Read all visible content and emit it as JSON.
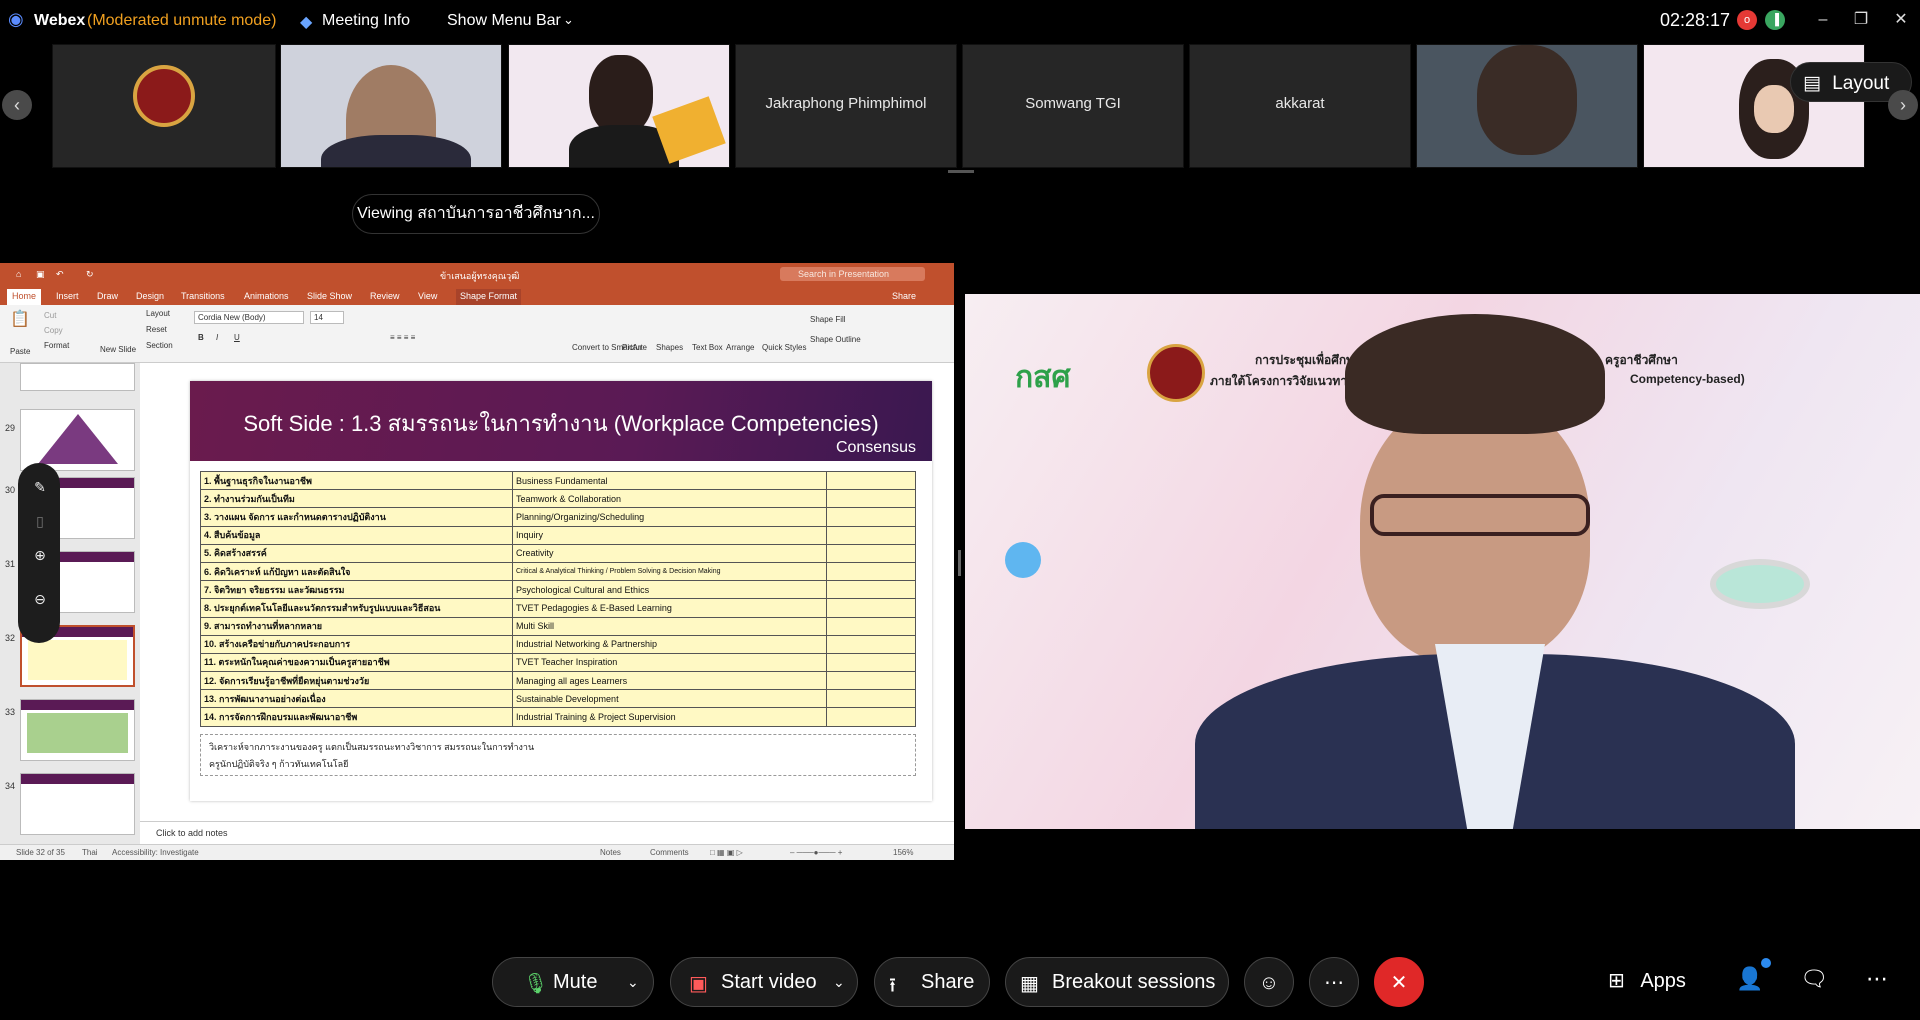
{
  "titlebar": {
    "app": "Webex",
    "mode": "(Moderated unmute mode)",
    "meeting_info": "Meeting Info",
    "show_menu": "Show Menu Bar",
    "time": "02:28:17"
  },
  "participants": [
    {
      "name": "Jakraphong Phimphimol"
    },
    {
      "name": "Somwang TGI"
    },
    {
      "name": "akkarat"
    }
  ],
  "layout_button": "Layout",
  "viewing": "Viewing สถาบันการอาชีวศึกษาก...",
  "ppt": {
    "doc_title": "ข้าเสนอผู้ทรงคุณวุฒิ",
    "search_placeholder": "Search in Presentation",
    "tabs": [
      "Home",
      "Insert",
      "Draw",
      "Design",
      "Transitions",
      "Animations",
      "Slide Show",
      "Review",
      "View",
      "Shape Format"
    ],
    "share": "Share",
    "ribbon": {
      "paste": "Paste",
      "cut": "Cut",
      "copy": "Copy",
      "format": "Format",
      "new_slide": "New Slide",
      "layout": "Layout",
      "reset": "Reset",
      "section": "Section",
      "font": "Cordia New (Body)",
      "size": "14",
      "convert": "Convert to SmartArt",
      "picture": "Picture",
      "shapes": "Shapes",
      "textbox": "Text Box",
      "arrange": "Arrange",
      "quick_styles": "Quick Styles",
      "shape_fill": "Shape Fill",
      "shape_outline": "Shape Outline"
    },
    "thumb_numbers": [
      "29",
      "30",
      "31",
      "32",
      "33",
      "34"
    ],
    "slide": {
      "title": "Soft Side : 1.3 สมรรถนะในการทำงาน (Workplace Competencies)",
      "subtitle": "Consensus",
      "rows": [
        {
          "th": "1. พื้นฐานธุรกิจในงานอาชีพ",
          "en": "Business Fundamental"
        },
        {
          "th": "2. ทำงานร่วมกันเป็นทีม",
          "en": "Teamwork & Collaboration"
        },
        {
          "th": "3. วางแผน จัดการ และกำหนดตารางปฏิบัติงาน",
          "en": "Planning/Organizing/Scheduling"
        },
        {
          "th": "4. สืบค้นข้อมูล",
          "en": "Inquiry"
        },
        {
          "th": "5. คิดสร้างสรรค์",
          "en": "Creativity"
        },
        {
          "th": "6. คิดวิเคราะห์ แก้ปัญหา และตัดสินใจ",
          "en": "Critical & Analytical Thinking / Problem Solving & Decision Making"
        },
        {
          "th": "7. จิตวิทยา จริยธรรม และวัฒนธรรม",
          "en": "Psychological Cultural and Ethics"
        },
        {
          "th": "8. ประยุกต์เทคโนโลยีและนวัตกรรมสำหรับรูปแบบและวิธีสอน",
          "en": "TVET Pedagogies & E-Based Learning"
        },
        {
          "th": "9. สามารถทำงานที่หลากหลาย",
          "en": "Multi Skill"
        },
        {
          "th": "10. สร้างเครือข่ายกับภาคประกอบการ",
          "en": "Industrial Networking & Partnership"
        },
        {
          "th": "11. ตระหนักในคุณค่าของความเป็นครูสายอาชีพ",
          "en": "TVET Teacher Inspiration"
        },
        {
          "th": "12. จัดการเรียนรู้อาชีพที่ยืดหยุ่นตามช่วงวัย",
          "en": "Managing all ages Learners"
        },
        {
          "th": "13. การพัฒนางานอย่างต่อเนื่อง",
          "en": "Sustainable Development"
        },
        {
          "th": "14. การจัดการฝึกอบรมและพัฒนาอาชีพ",
          "en": "Industrial Training & Project Supervision"
        }
      ],
      "note_line1": "วิเคราะห์จากภาระงานของครู แตกเป็นสมรรถนะทางวิชาการ สมรรถนะในการทำงาน",
      "note_line2": "ครูนักปฏิบัติจริง ๆ ก้าวทันเทคโนโลยี"
    },
    "notes_placeholder": "Click to add notes",
    "status": {
      "slide": "Slide 32 of 35",
      "lang": "Thai",
      "access": "Accessibility: Investigate",
      "notes": "Notes",
      "comments": "Comments",
      "zoom": "156%"
    }
  },
  "video_banner": {
    "org": "กสศ",
    "line1": "การประชุมเพื่อศึกษาความ",
    "line1b": "ครูอาชีวศึกษา",
    "line2": "ภายใต้โครงการวิจัยเนวทางการย",
    "line2b": "Competency-based)"
  },
  "controls": {
    "mute": "Mute",
    "start_video": "Start video",
    "share": "Share",
    "breakout": "Breakout sessions",
    "apps": "Apps"
  },
  "colors": {
    "accent_orange": "#f0a020",
    "end_red": "#e02828",
    "ppt_orange": "#c0502d",
    "slide_purple": "#5a1a55",
    "row_yellow": "#fff9c4"
  }
}
